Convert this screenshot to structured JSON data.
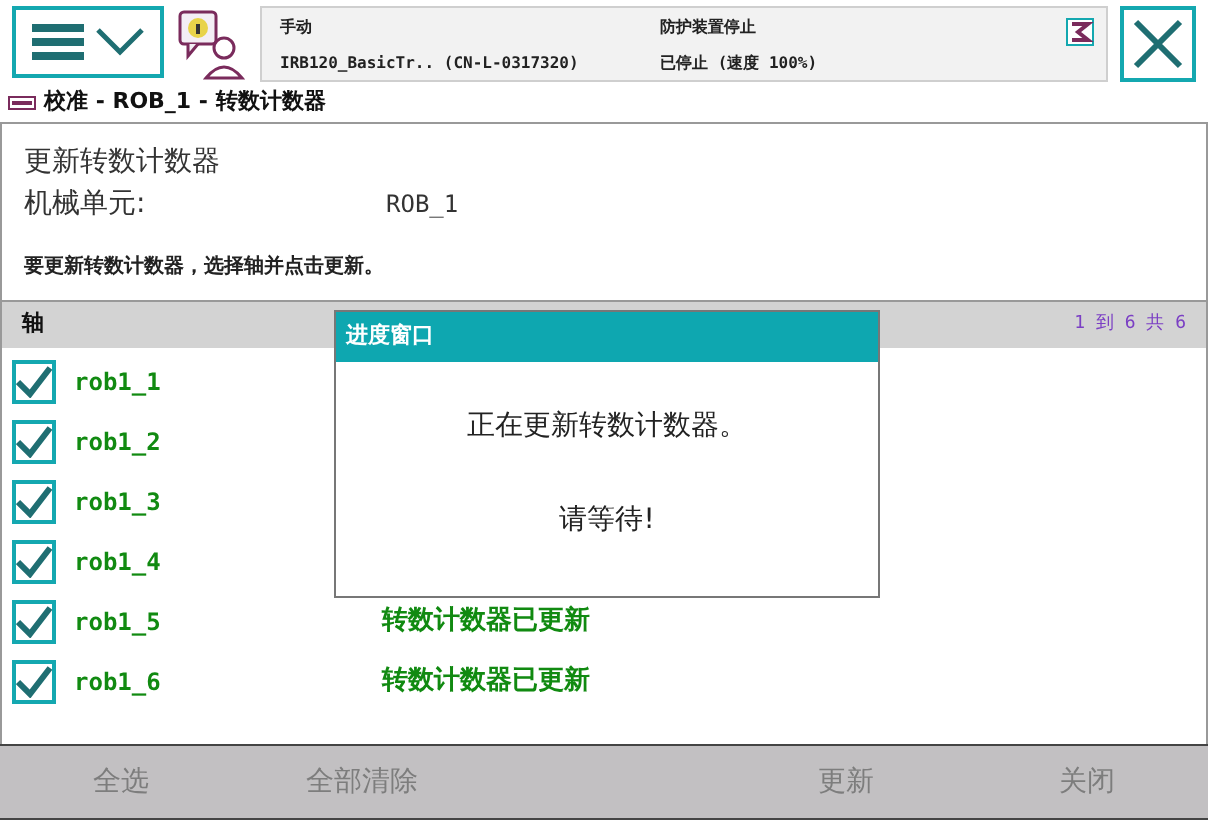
{
  "status": {
    "mode": "手动",
    "system": "IRB120_BasicTr.. (CN-L-0317320)",
    "safety": "防护装置停止",
    "state": "已停止 (速度 100%)"
  },
  "breadcrumb": "校准 - ROB_1 - 转数计数器",
  "heading": "更新转数计数器",
  "mech_unit": {
    "label": "机械单元:",
    "value": "ROB_1"
  },
  "instruction": "要更新转数计数器，选择轴并点击更新。",
  "table": {
    "column": "轴",
    "paging": "1 到 6 共 6",
    "rows": [
      {
        "axis": "rob1_1",
        "checked": true
      },
      {
        "axis": "rob1_2",
        "checked": true
      },
      {
        "axis": "rob1_3",
        "checked": true
      },
      {
        "axis": "rob1_4",
        "checked": true
      },
      {
        "axis": "rob1_5",
        "checked": true,
        "status": "转数计数器已更新"
      },
      {
        "axis": "rob1_6",
        "checked": true,
        "status": "转数计数器已更新"
      }
    ]
  },
  "dialog": {
    "title": "进度窗口",
    "message": "正在更新转数计数器。",
    "wait": "请等待!"
  },
  "buttons": [
    {
      "label": "全选",
      "disabled": true
    },
    {
      "label": "全部清除",
      "disabled": true
    },
    {
      "label": "更新",
      "disabled": true
    },
    {
      "label": "关闭",
      "disabled": true
    }
  ]
}
